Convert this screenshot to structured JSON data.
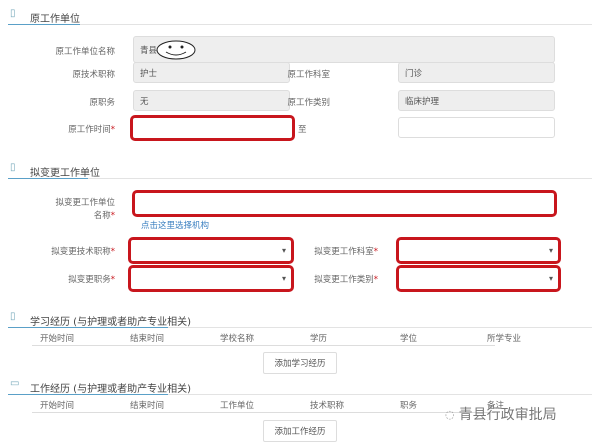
{
  "section1": {
    "title": "原工作单位",
    "fields": {
      "unit_name_label": "原工作单位名称",
      "unit_name_value": "青县",
      "tech_title_label": "原技术职称",
      "tech_title_value": "护士",
      "dept_label": "原工作科室",
      "dept_value": "门诊",
      "position_label": "原职务",
      "position_value": "无",
      "category_label": "原工作类别",
      "category_value": "临床护理",
      "time_label": "原工作时间",
      "to_label": "至"
    }
  },
  "section2": {
    "title": "拟变更工作单位",
    "unit_label_1": "拟变更工作单位",
    "unit_label_2": "名称",
    "select_link": "点击这里选择机构",
    "tech_title_label": "拟变更技术职称",
    "dept_label": "拟变更工作科室",
    "position_label": "拟变更职务",
    "category_label": "拟变更工作类别"
  },
  "required_mark": "*",
  "study": {
    "title": "学习经历 (与护理或者助产专业相关)",
    "columns": [
      "开始时间",
      "结束时间",
      "学校名称",
      "学历",
      "学位",
      "所学专业"
    ],
    "add_button": "添加学习经历"
  },
  "work": {
    "title": "工作经历 (与护理或者助产专业相关)",
    "columns": [
      "开始时间",
      "结束时间",
      "工作单位",
      "技术职称",
      "职务",
      "备注"
    ],
    "add_button": "添加工作经历"
  },
  "watermark": "青县行政审批局"
}
